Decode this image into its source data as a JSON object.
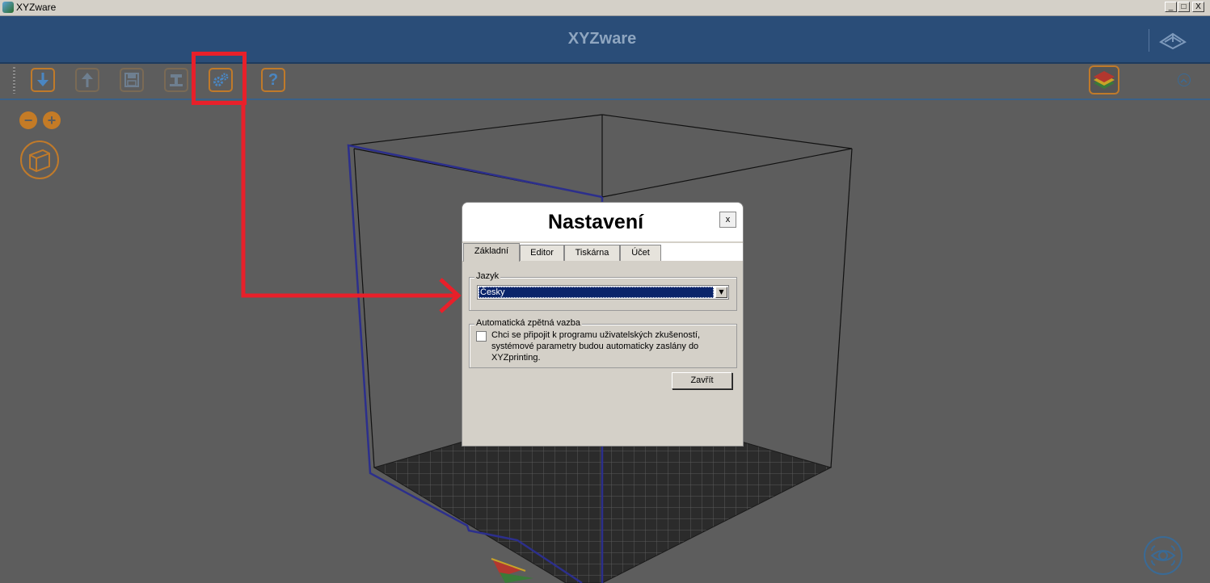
{
  "window": {
    "title": "XYZware",
    "controls": {
      "minimize": "_",
      "maximize": "□",
      "close": "X"
    }
  },
  "header": {
    "title": "XYZware",
    "logo_icon": "xyz-logo-icon"
  },
  "toolbar": {
    "buttons": [
      {
        "name": "import",
        "icon": "download-arrow-icon",
        "enabled": true
      },
      {
        "name": "export",
        "icon": "upload-arrow-icon",
        "enabled": false
      },
      {
        "name": "save",
        "icon": "floppy-disk-icon",
        "enabled": false
      },
      {
        "name": "print",
        "icon": "printer-icon",
        "enabled": false
      },
      {
        "name": "settings",
        "icon": "gears-icon",
        "enabled": true,
        "highlighted": true
      },
      {
        "name": "help",
        "icon": "question-mark-icon",
        "label": "?",
        "enabled": true
      }
    ],
    "right_buttons": [
      {
        "name": "layers",
        "icon": "layers-icon"
      },
      {
        "name": "collapse",
        "icon": "chevron-up-circle-icon"
      }
    ]
  },
  "viewport": {
    "zoom_out_label": "−",
    "zoom_in_label": "+",
    "view_cube_icon": "cube-icon",
    "view_icon": "eye-icon"
  },
  "colors": {
    "accent_orange": "#c47b26",
    "header_blue": "#2a4d78",
    "annotation_red": "#e8202a",
    "selection_blue": "#0a246a"
  },
  "settings_dialog": {
    "title": "Nastavení",
    "close_label": "x",
    "tabs": [
      {
        "label": "Základní",
        "active": true
      },
      {
        "label": "Editor",
        "active": false
      },
      {
        "label": "Tiskárna",
        "active": false
      },
      {
        "label": "Účet",
        "active": false
      }
    ],
    "language_group": {
      "legend": "Jazyk",
      "selected_language": "Česky"
    },
    "feedback_group": {
      "legend": "Automatická zpětná vazba",
      "checked": false,
      "checkbox_text": "Chci se připojit k programu uživatelských zkušeností, systémové parametry budou automaticky zaslány do XYZprinting."
    },
    "close_button": "Zavřít"
  }
}
